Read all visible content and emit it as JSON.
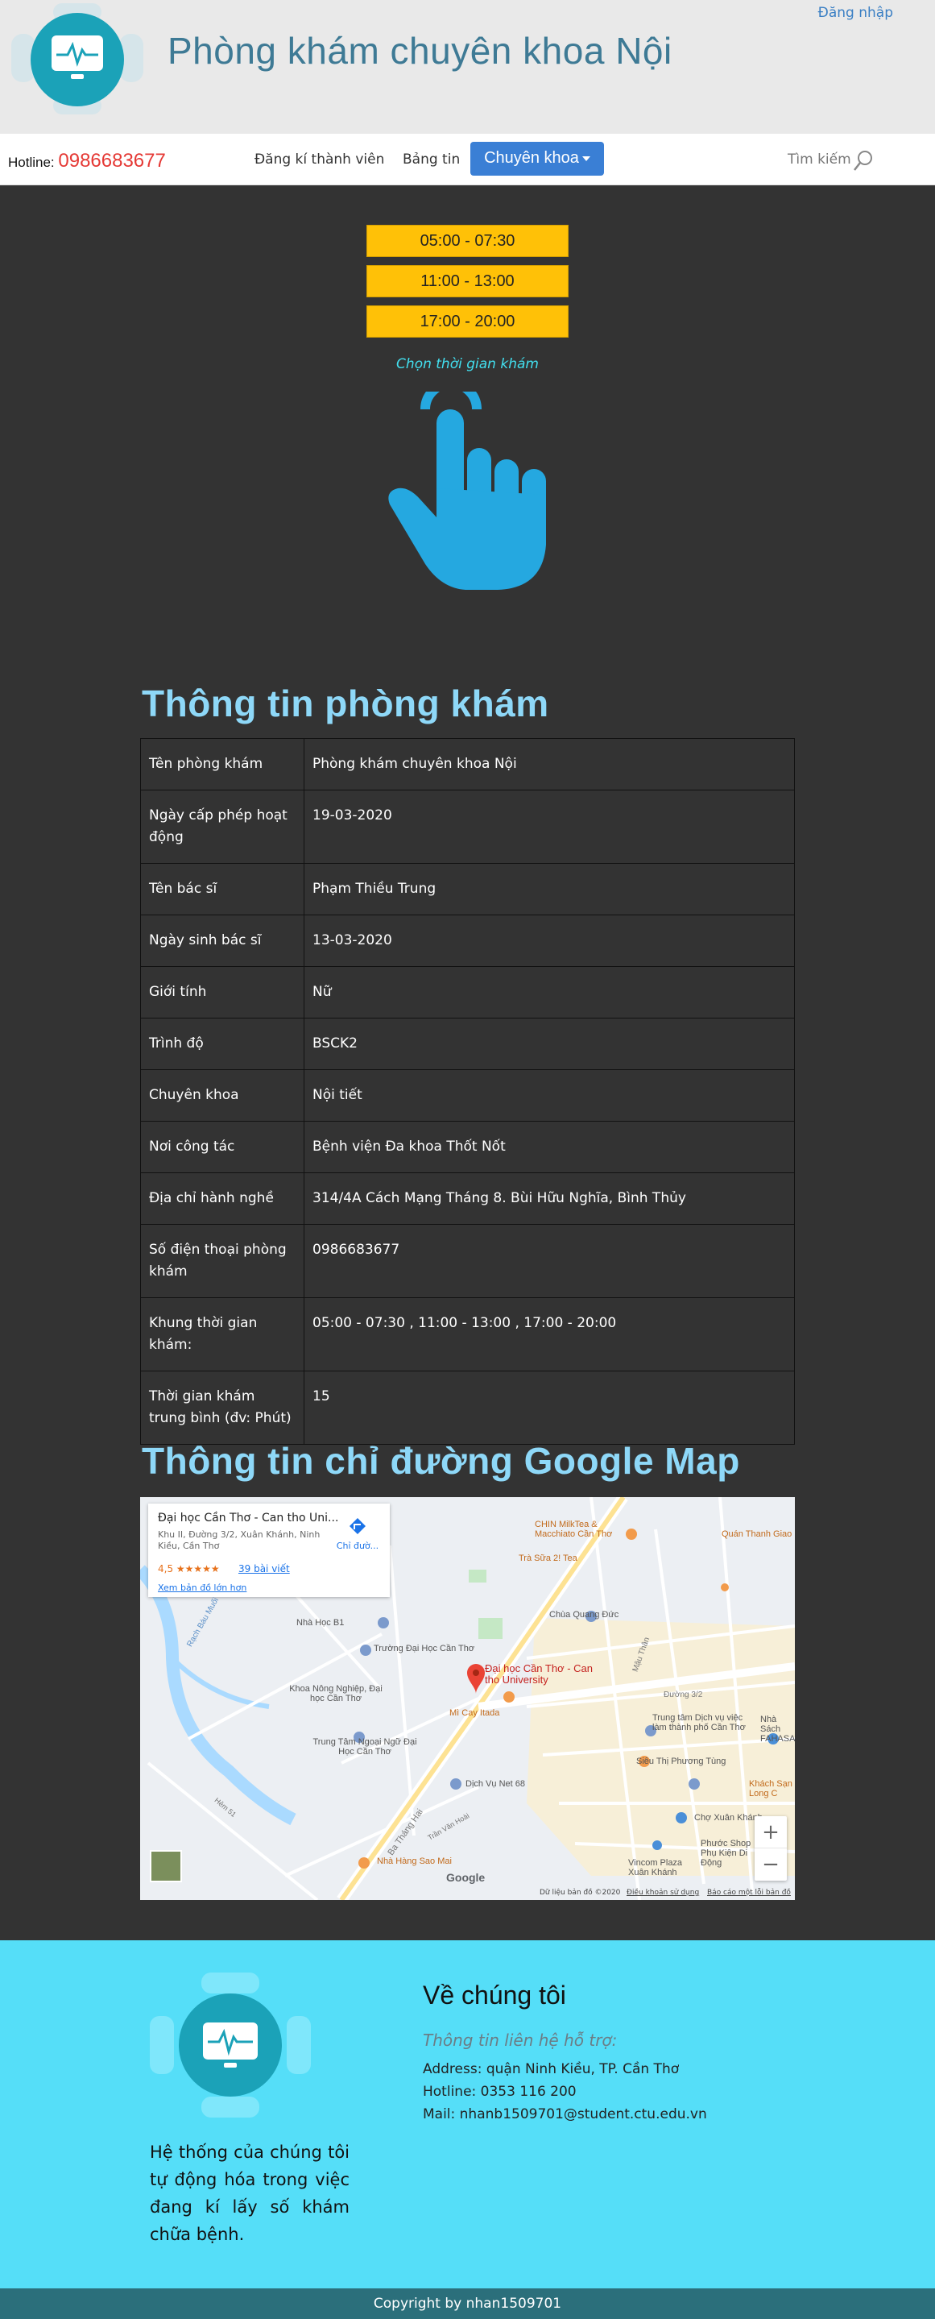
{
  "header": {
    "title": "Phòng khám chuyên khoa Nội",
    "login_label": "Đăng nhập"
  },
  "nav": {
    "hotline_label": "Hotline:",
    "hotline_number": "0986683677",
    "items": [
      "Đăng kí thành viên",
      "Bảng tin"
    ],
    "dropdown_label": "Chuyên khoa",
    "search_placeholder": "Tìm kiếm"
  },
  "booking": {
    "slots": [
      "05:00 - 07:30",
      "11:00 - 13:00",
      "17:00 - 20:00"
    ],
    "choose_label": "Chọn thời gian khám",
    "pointer_icon": "pointing-hand-icon"
  },
  "info": {
    "title": "Thông tin phòng khám",
    "rows": [
      {
        "label": "Tên phòng khám",
        "value": "Phòng khám chuyên khoa Nội"
      },
      {
        "label": "Ngày cấp phép hoạt động",
        "value": "19-03-2020"
      },
      {
        "label": "Tên bác sĩ",
        "value": "Phạm Thiều Trung"
      },
      {
        "label": "Ngày sinh bác sĩ",
        "value": "13-03-2020"
      },
      {
        "label": "Giới tính",
        "value": "Nữ"
      },
      {
        "label": "Trình độ",
        "value": "BSCK2"
      },
      {
        "label": "Chuyên khoa",
        "value": "Nội tiết"
      },
      {
        "label": "Nơi công tác",
        "value": "Bệnh viện Đa khoa Thốt Nốt"
      },
      {
        "label": "Địa chỉ hành nghề",
        "value": "314/4A Cách Mạng Tháng 8. Bùi Hữu Nghĩa, Bình Thủy"
      },
      {
        "label": "Số điện thoại phòng khám",
        "value": "0986683677"
      },
      {
        "label": "Khung thời gian khám:",
        "value": "05:00 - 07:30 , 11:00 - 13:00 , 17:00 - 20:00"
      },
      {
        "label": "Thời gian khám trung bình (đv: Phút)",
        "value": "15"
      }
    ]
  },
  "map": {
    "title": "Thông tin chỉ đường Google Map",
    "card_title": "Đại học Cần Thơ - Can tho Uni...",
    "card_address": "Khu II, Đường 3/2, Xuân Khánh, Ninh Kiều, Cần Thơ",
    "card_rating": "4,5 ★★★★★",
    "card_reviews": "39 bài viết",
    "card_bigger": "Xem bản đồ lớn hơn",
    "card_directions": "Chỉ đườ...",
    "pin_label": "Đại học Cần Thơ - Can tho University",
    "places": [
      "CHIN MilkTea & Macchiato Cần Thơ",
      "Quán Thanh Giao",
      "Trà Sữa 2! Tea",
      "Chùa Quang Đức",
      "Nhà Học B1",
      "Trường Đại Học Cần Thơ",
      "Khoa Nông Nghiệp, Đại học Cần Thơ",
      "Mì Cay Itada",
      "Trung tâm Dịch vụ việc làm thành phố Cần Thơ",
      "Nhà Sách FAHASA",
      "Trung Tâm Ngoại Ngữ Đại Học Cần Thơ",
      "Siêu Thị Phương Tùng",
      "Dịch Vụ Net 68",
      "Khách Sạn Long C",
      "Chợ Xuân Khánh",
      "Phước Shop Phụ Kiện Di Động",
      "Vincom Plaza Xuân Khánh",
      "Nhà Hàng Sao Mai"
    ],
    "streets": [
      "Rạch Bàu Muối",
      "Đường 3/2",
      "Ba Tháng Hai",
      "Trần Văn Hoài",
      "Mậu Thân",
      "Hẻm 51"
    ],
    "zoom_in": "+",
    "zoom_out": "−",
    "google_logo": "Google",
    "footer_data": "Dữ liệu bản đồ ©2020",
    "footer_terms": "Điều khoản sử dụng",
    "footer_report": "Báo cáo một lỗi bản đồ"
  },
  "footer": {
    "about_title": "Về chúng tôi",
    "support_title": "Thông tin liên hệ hỗ trợ:",
    "address": "Address: quận Ninh Kiều, TP. Cần Thơ",
    "hotline": "Hotline: 0353 116 200",
    "mail": "Mail: nhanb1509701@student.ctu.edu.vn",
    "description": "Hệ thống của chúng tôi tự động hóa trong việc đang kí lấy số khám chữa bệnh.",
    "copyright": "Copyright by nhan1509701"
  },
  "colors": {
    "accent_blue": "#3a7fd5",
    "slot_yellow": "#ffc107",
    "title_cyan": "#8ed8f8",
    "footer_cyan": "#55def8",
    "hotline_red": "#e53935"
  }
}
